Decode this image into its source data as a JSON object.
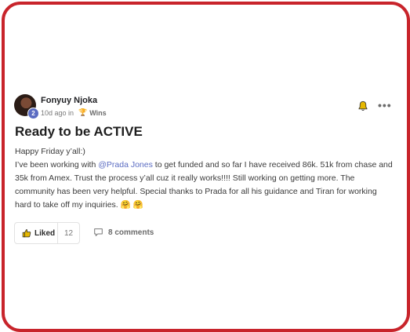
{
  "post": {
    "author": "Fonyuy Njoka",
    "level": "2",
    "time_ago": "10d ago in",
    "category": "Wins",
    "category_icon": "trophy-icon",
    "title": "Ready to be ACTIVE",
    "greeting": "Happy Friday y’all:)",
    "body_before_mention": "I’ve been working with ",
    "mention": "@Prada Jones",
    "body_after_mention": " to get funded and so far I have received 86k. 51k from chase and 35k from Amex. Trust the process y’all cuz it really works!!!! Still working on getting more. The community has been very helpful. Special thanks to Prada for all his guidance and Tiran for working hard to take off my inquiries. 🤗 🤗"
  },
  "actions": {
    "like_label": "Liked",
    "like_count": "12",
    "comments_label": "8 comments"
  },
  "colors": {
    "frame": "#c8242b",
    "mention": "#5b6cc2",
    "bell": "#e6b800"
  }
}
